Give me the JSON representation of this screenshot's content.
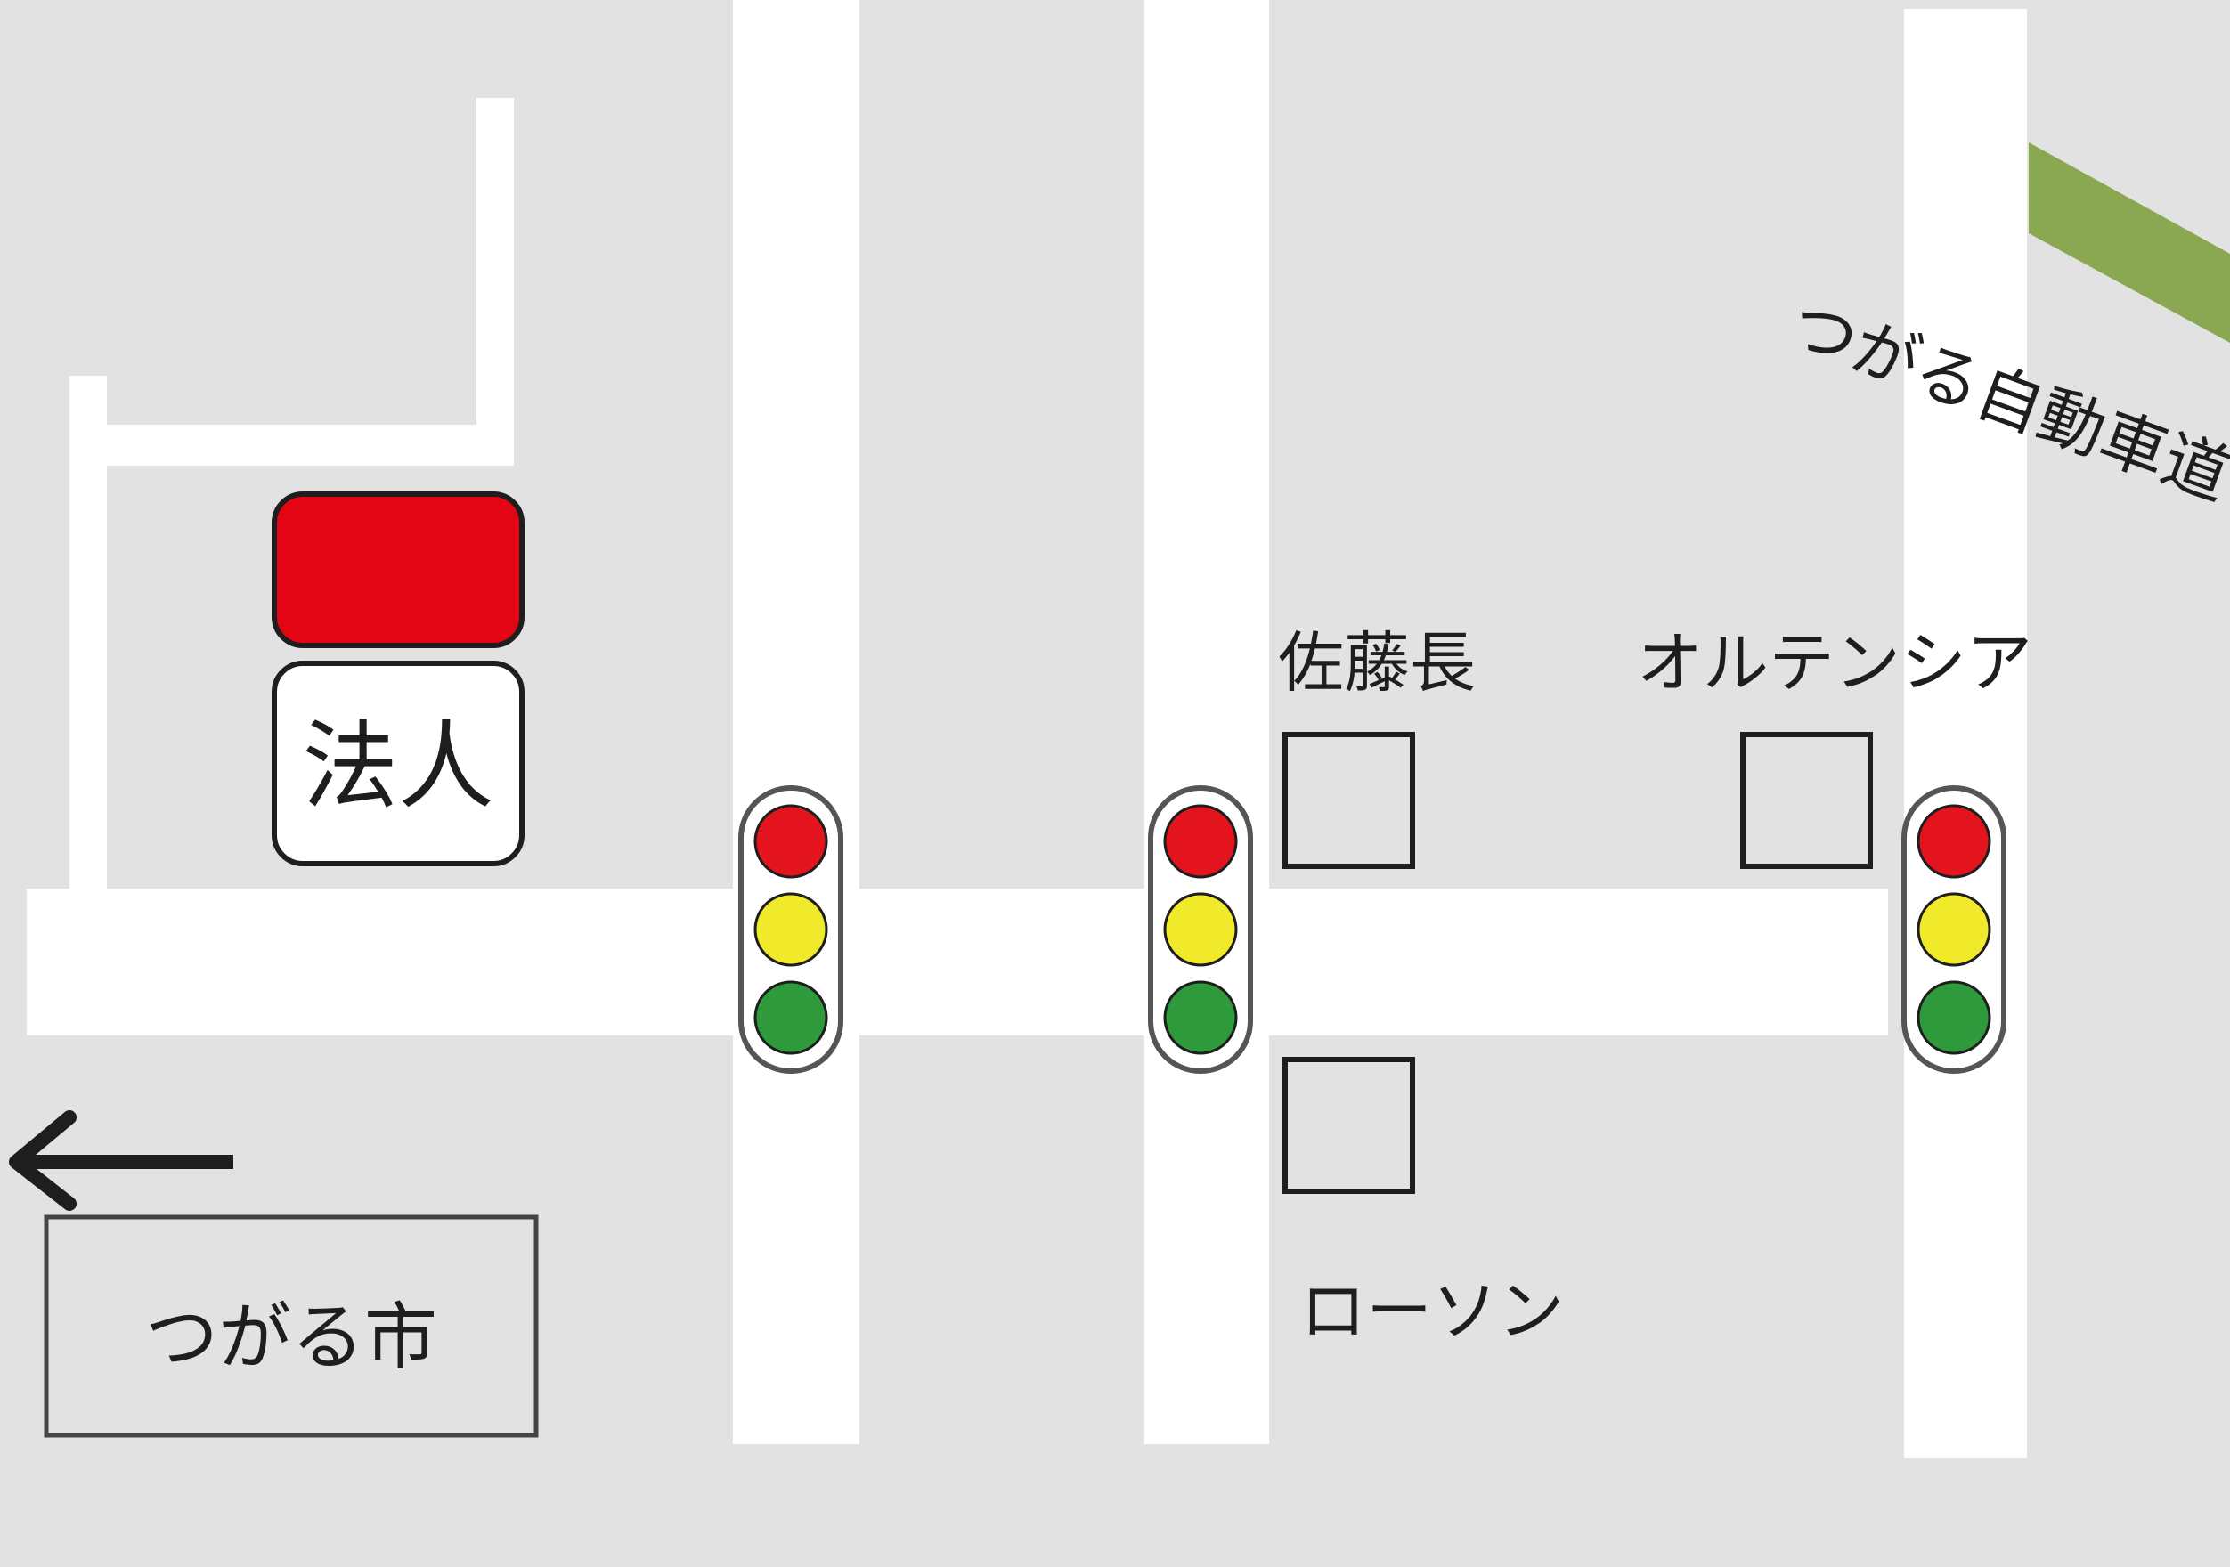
{
  "labels": {
    "corporation": "法人",
    "sato": "佐藤長",
    "hortensia": "オルテンシア",
    "lawson": "ローソン",
    "expressway": "つがる自動車道",
    "city": "つがる市"
  },
  "icons": {
    "direction": "arrow-left-icon",
    "traffic_light": "traffic-light-icon",
    "shop": "shop-marker-icon"
  },
  "colors": {
    "background": "#e2e2e2",
    "road": "#ffffff",
    "expressway": "#8aa852",
    "marker_red": "#e30414",
    "signal_red": "#e3141d",
    "signal_yellow": "#f1ea2a",
    "signal_green": "#2e9a3c",
    "line": "#1e1e1e"
  }
}
